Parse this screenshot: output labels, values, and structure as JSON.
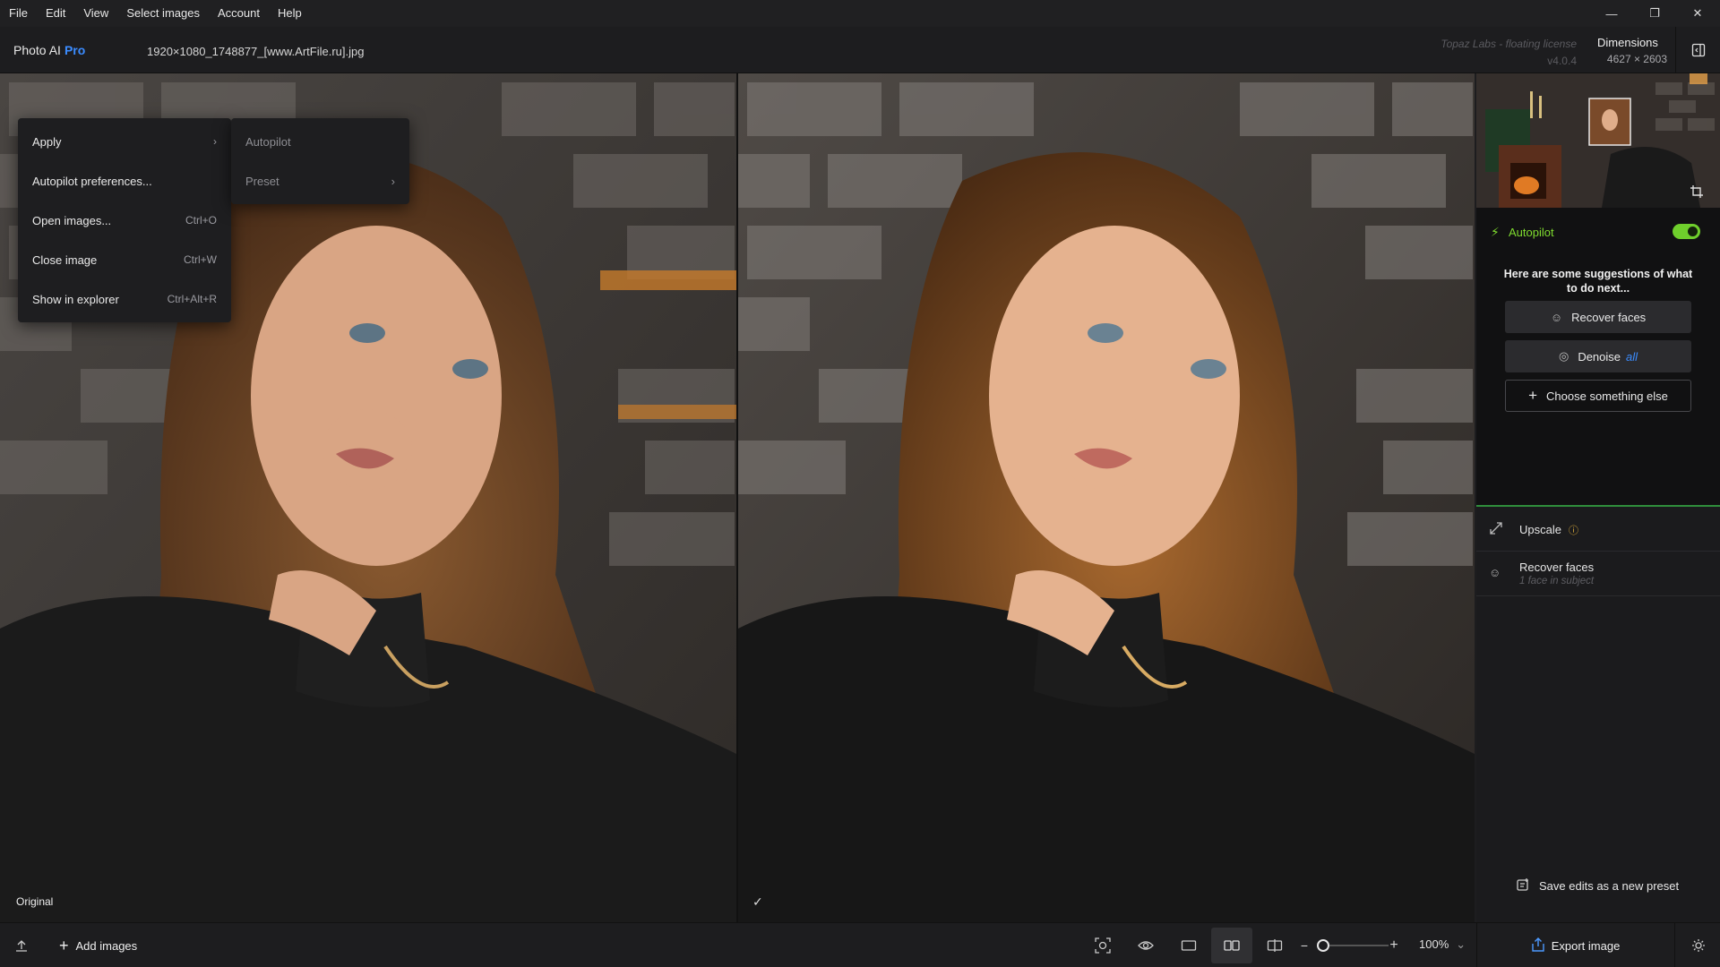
{
  "menubar": {
    "items": [
      "File",
      "Edit",
      "View",
      "Select images",
      "Account",
      "Help"
    ]
  },
  "window": {
    "minimize": "—",
    "restore": "❐",
    "close": "✕"
  },
  "header": {
    "brand": "Photo AI",
    "brand_tier": "Pro",
    "filename": "1920×1080_1748877_[www.ArtFile.ru].jpg",
    "license": "Topaz Labs - floating license",
    "version": "v4.0.4",
    "dimensions_label": "Dimensions",
    "dimensions_value": "4627 × 2603"
  },
  "viewer": {
    "left_caption": "Original",
    "right_check": "✓"
  },
  "context_menu": {
    "items": [
      {
        "label": "Apply",
        "shortcut": "›"
      },
      {
        "label": "Autopilot preferences...",
        "shortcut": ""
      },
      {
        "label": "Open images...",
        "shortcut": "Ctrl+O"
      },
      {
        "label": "Close image",
        "shortcut": "Ctrl+W"
      },
      {
        "label": "Show in explorer",
        "shortcut": "Ctrl+Alt+R"
      }
    ],
    "submenu": [
      {
        "label": "Autopilot",
        "arrow": ""
      },
      {
        "label": "Preset",
        "arrow": "›"
      }
    ]
  },
  "autopilot": {
    "title": "Autopilot",
    "enabled": true,
    "suggestion_text": "Here are some suggestions of what to do next...",
    "suggestions": [
      {
        "label": "Recover faces",
        "icon": "face-icon"
      },
      {
        "label": "Denoise",
        "badge": "all",
        "icon": "denoise-icon"
      },
      {
        "label": "Choose something else",
        "icon": "plus-icon"
      }
    ]
  },
  "tools": [
    {
      "name": "Upscale",
      "icon": "upscale-icon",
      "info": "ⓘ"
    },
    {
      "name": "Recover faces",
      "detail": "1 face in subject",
      "icon": "face-icon"
    }
  ],
  "save_preset": "Save edits as a new preset",
  "bottombar": {
    "add_images": "Add images",
    "zoom": "100%",
    "export": "Export image"
  },
  "colors": {
    "accent_blue": "#3b8cff",
    "autopilot_green": "#7fdc2f",
    "info_yellow": "#e3b23c"
  }
}
